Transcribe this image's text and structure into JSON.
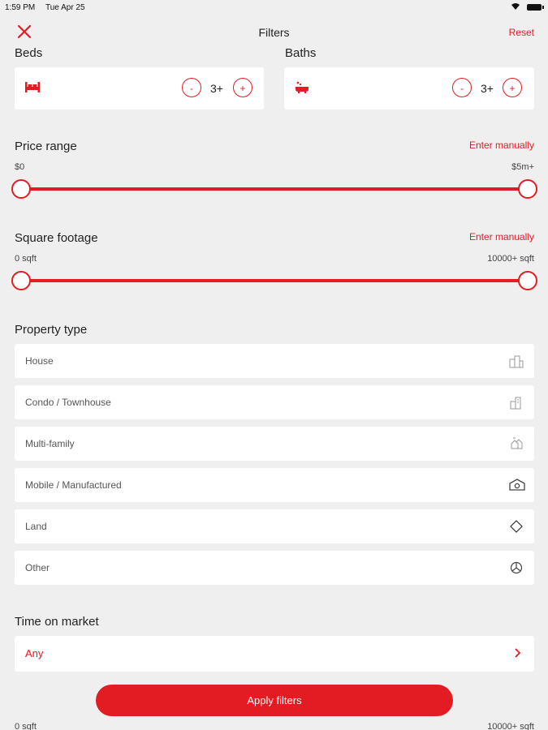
{
  "status_bar": {
    "time": "1:59 PM",
    "date": "Tue Apr 25"
  },
  "header": {
    "title": "Filters",
    "reset_label": "Reset"
  },
  "beds": {
    "label": "Beds",
    "value": "3+",
    "minus": "-",
    "plus": "+"
  },
  "baths": {
    "label": "Baths",
    "value": "3+",
    "minus": "-",
    "plus": "+"
  },
  "price_range": {
    "label": "Price range",
    "enter_manually": "Enter manually",
    "min_label": "$0",
    "max_label": "$5m+",
    "min_fraction": 0,
    "max_fraction": 1
  },
  "square_footage": {
    "label": "Square footage",
    "enter_manually": "Enter manually",
    "min_label": "0 sqft",
    "max_label": "10000+ sqft",
    "min_fraction": 0,
    "max_fraction": 1
  },
  "property_type": {
    "label": "Property type",
    "items": [
      {
        "label": "House",
        "icon": "building-icon"
      },
      {
        "label": "Condo / Townhouse",
        "icon": "townhouse-icon"
      },
      {
        "label": "Multi-family",
        "icon": "multi-family-icon"
      },
      {
        "label": "Mobile / Manufactured",
        "icon": "mobile-home-icon"
      },
      {
        "label": "Land",
        "icon": "land-diamond-icon"
      },
      {
        "label": "Other",
        "icon": "other-icon"
      }
    ]
  },
  "time_on_market": {
    "label": "Time on market",
    "value": "Any"
  },
  "apply_label": "Apply filters",
  "footer_peek": {
    "left": "0 sqft",
    "right": "10000+ sqft"
  },
  "colors": {
    "accent": "#e31b23",
    "background": "#efefef",
    "card": "#ffffff"
  }
}
